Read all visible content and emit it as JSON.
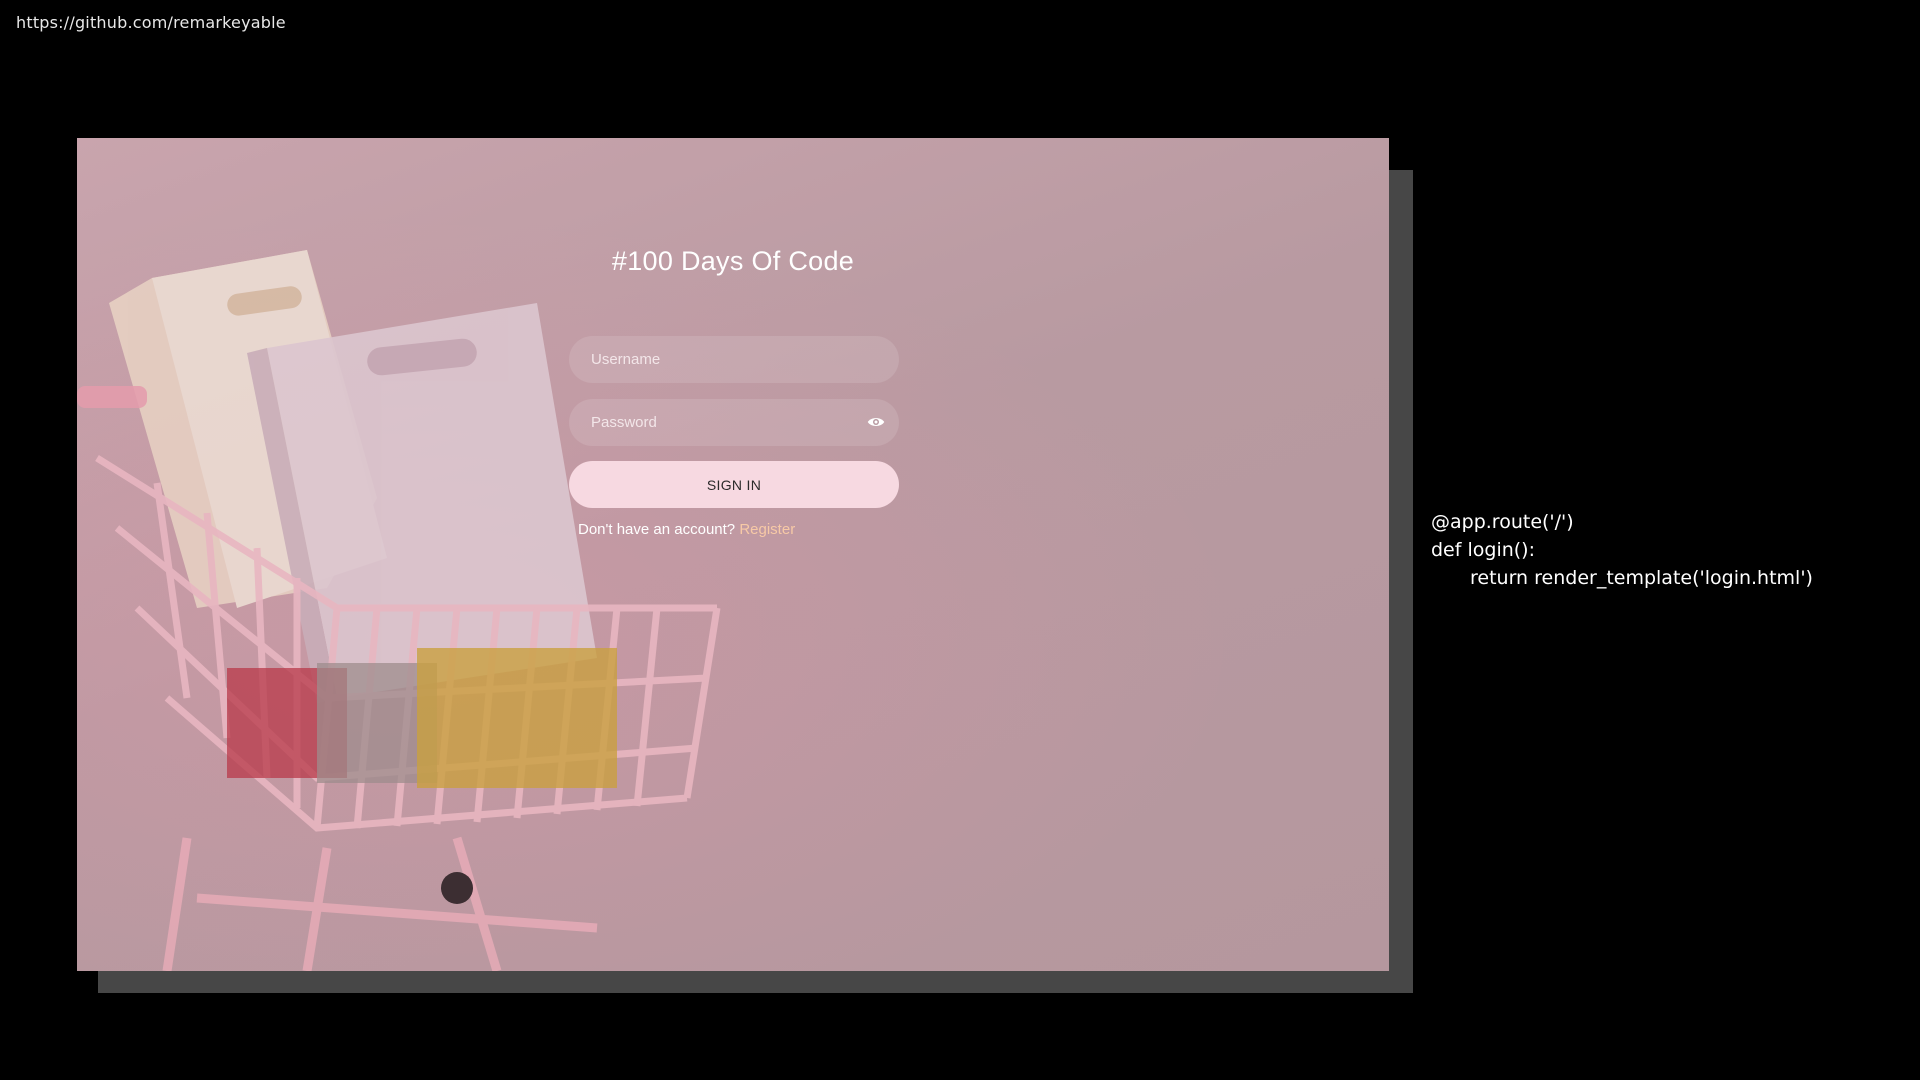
{
  "caption": {
    "url": "https://github.com/remarkeyable"
  },
  "login": {
    "title": "#100 Days Of Code",
    "username_placeholder": "Username",
    "password_placeholder": "Password",
    "eye_icon": "eye-icon",
    "signin_label": "SIGN IN",
    "no_account_text": "Don't have an account?",
    "register_label": "Register"
  },
  "code_snippet": {
    "lines": [
      "@app.route('/')",
      "def login():",
      "return render_template('login.html')"
    ]
  },
  "colors": {
    "page_background": "#000000",
    "frame_shadow": "#474747",
    "screen_tint": "#b89aa1",
    "signin_button": "#f7d9e1",
    "register_link": "#f7c9a6"
  }
}
